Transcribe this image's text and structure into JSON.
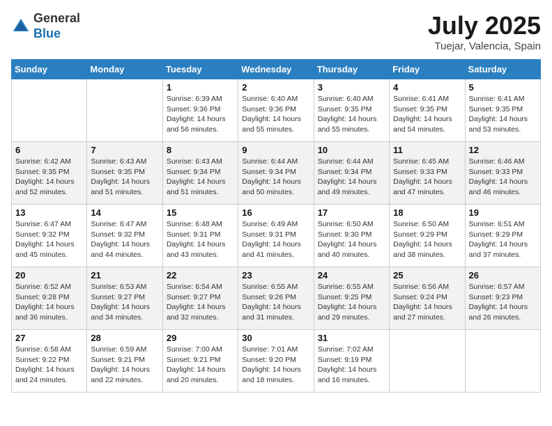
{
  "logo": {
    "general": "General",
    "blue": "Blue"
  },
  "title": {
    "month": "July 2025",
    "location": "Tuejar, Valencia, Spain"
  },
  "headers": [
    "Sunday",
    "Monday",
    "Tuesday",
    "Wednesday",
    "Thursday",
    "Friday",
    "Saturday"
  ],
  "weeks": [
    [
      {
        "day": "",
        "detail": ""
      },
      {
        "day": "",
        "detail": ""
      },
      {
        "day": "1",
        "detail": "Sunrise: 6:39 AM\nSunset: 9:36 PM\nDaylight: 14 hours and 56 minutes."
      },
      {
        "day": "2",
        "detail": "Sunrise: 6:40 AM\nSunset: 9:36 PM\nDaylight: 14 hours and 55 minutes."
      },
      {
        "day": "3",
        "detail": "Sunrise: 6:40 AM\nSunset: 9:35 PM\nDaylight: 14 hours and 55 minutes."
      },
      {
        "day": "4",
        "detail": "Sunrise: 6:41 AM\nSunset: 9:35 PM\nDaylight: 14 hours and 54 minutes."
      },
      {
        "day": "5",
        "detail": "Sunrise: 6:41 AM\nSunset: 9:35 PM\nDaylight: 14 hours and 53 minutes."
      }
    ],
    [
      {
        "day": "6",
        "detail": "Sunrise: 6:42 AM\nSunset: 9:35 PM\nDaylight: 14 hours and 52 minutes."
      },
      {
        "day": "7",
        "detail": "Sunrise: 6:43 AM\nSunset: 9:35 PM\nDaylight: 14 hours and 51 minutes."
      },
      {
        "day": "8",
        "detail": "Sunrise: 6:43 AM\nSunset: 9:34 PM\nDaylight: 14 hours and 51 minutes."
      },
      {
        "day": "9",
        "detail": "Sunrise: 6:44 AM\nSunset: 9:34 PM\nDaylight: 14 hours and 50 minutes."
      },
      {
        "day": "10",
        "detail": "Sunrise: 6:44 AM\nSunset: 9:34 PM\nDaylight: 14 hours and 49 minutes."
      },
      {
        "day": "11",
        "detail": "Sunrise: 6:45 AM\nSunset: 9:33 PM\nDaylight: 14 hours and 47 minutes."
      },
      {
        "day": "12",
        "detail": "Sunrise: 6:46 AM\nSunset: 9:33 PM\nDaylight: 14 hours and 46 minutes."
      }
    ],
    [
      {
        "day": "13",
        "detail": "Sunrise: 6:47 AM\nSunset: 9:32 PM\nDaylight: 14 hours and 45 minutes."
      },
      {
        "day": "14",
        "detail": "Sunrise: 6:47 AM\nSunset: 9:32 PM\nDaylight: 14 hours and 44 minutes."
      },
      {
        "day": "15",
        "detail": "Sunrise: 6:48 AM\nSunset: 9:31 PM\nDaylight: 14 hours and 43 minutes."
      },
      {
        "day": "16",
        "detail": "Sunrise: 6:49 AM\nSunset: 9:31 PM\nDaylight: 14 hours and 41 minutes."
      },
      {
        "day": "17",
        "detail": "Sunrise: 6:50 AM\nSunset: 9:30 PM\nDaylight: 14 hours and 40 minutes."
      },
      {
        "day": "18",
        "detail": "Sunrise: 6:50 AM\nSunset: 9:29 PM\nDaylight: 14 hours and 38 minutes."
      },
      {
        "day": "19",
        "detail": "Sunrise: 6:51 AM\nSunset: 9:29 PM\nDaylight: 14 hours and 37 minutes."
      }
    ],
    [
      {
        "day": "20",
        "detail": "Sunrise: 6:52 AM\nSunset: 9:28 PM\nDaylight: 14 hours and 36 minutes."
      },
      {
        "day": "21",
        "detail": "Sunrise: 6:53 AM\nSunset: 9:27 PM\nDaylight: 14 hours and 34 minutes."
      },
      {
        "day": "22",
        "detail": "Sunrise: 6:54 AM\nSunset: 9:27 PM\nDaylight: 14 hours and 32 minutes."
      },
      {
        "day": "23",
        "detail": "Sunrise: 6:55 AM\nSunset: 9:26 PM\nDaylight: 14 hours and 31 minutes."
      },
      {
        "day": "24",
        "detail": "Sunrise: 6:55 AM\nSunset: 9:25 PM\nDaylight: 14 hours and 29 minutes."
      },
      {
        "day": "25",
        "detail": "Sunrise: 6:56 AM\nSunset: 9:24 PM\nDaylight: 14 hours and 27 minutes."
      },
      {
        "day": "26",
        "detail": "Sunrise: 6:57 AM\nSunset: 9:23 PM\nDaylight: 14 hours and 26 minutes."
      }
    ],
    [
      {
        "day": "27",
        "detail": "Sunrise: 6:58 AM\nSunset: 9:22 PM\nDaylight: 14 hours and 24 minutes."
      },
      {
        "day": "28",
        "detail": "Sunrise: 6:59 AM\nSunset: 9:21 PM\nDaylight: 14 hours and 22 minutes."
      },
      {
        "day": "29",
        "detail": "Sunrise: 7:00 AM\nSunset: 9:21 PM\nDaylight: 14 hours and 20 minutes."
      },
      {
        "day": "30",
        "detail": "Sunrise: 7:01 AM\nSunset: 9:20 PM\nDaylight: 14 hours and 18 minutes."
      },
      {
        "day": "31",
        "detail": "Sunrise: 7:02 AM\nSunset: 9:19 PM\nDaylight: 14 hours and 16 minutes."
      },
      {
        "day": "",
        "detail": ""
      },
      {
        "day": "",
        "detail": ""
      }
    ]
  ]
}
